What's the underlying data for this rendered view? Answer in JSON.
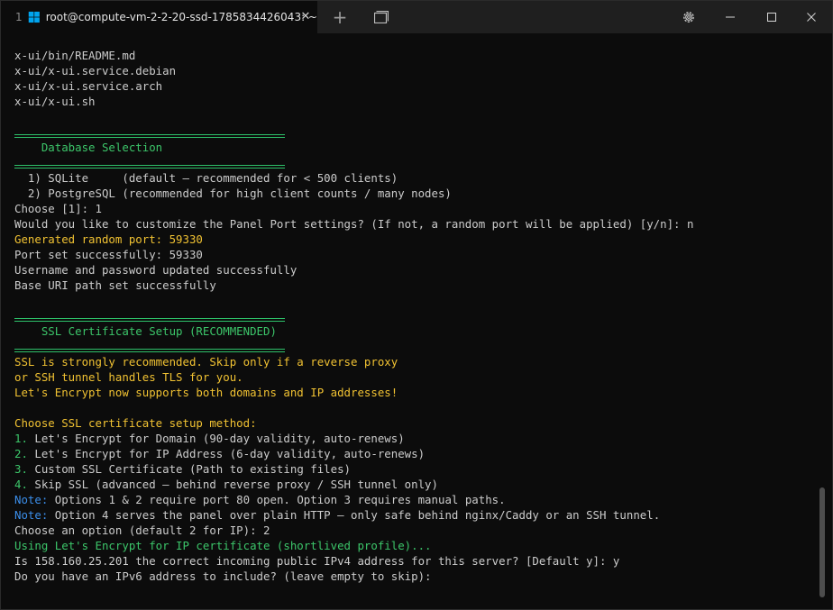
{
  "tab": {
    "index": "1",
    "title": "root@compute-vm-2-2-20-ssd-1785834426043: ~",
    "close_glyph": "✕",
    "icon": "windows-logo-icon"
  },
  "titlebar": {
    "new_tab_glyph": "+",
    "tab_view_icon": "tab-overview-icon",
    "settings_icon": "gear-icon",
    "minimize_icon": "minimize-icon",
    "maximize_icon": "maximize-icon",
    "close_icon": "close-icon"
  },
  "terminal": {
    "lines": [
      {
        "text": "x-ui/bin/README.md",
        "color": "default"
      },
      {
        "text": "x-ui/x-ui.service.debian",
        "color": "default"
      },
      {
        "text": "x-ui/x-ui.service.arch",
        "color": "default"
      },
      {
        "text": "x-ui/x-ui.sh",
        "color": "default"
      },
      {
        "text": "",
        "color": "default"
      },
      {
        "sep": true
      },
      {
        "text": "    Database Selection",
        "color": "green"
      },
      {
        "sep": true
      },
      {
        "text": "  1) SQLite     (default — recommended for < 500 clients)",
        "color": "default"
      },
      {
        "text": "  2) PostgreSQL (recommended for high client counts / many nodes)",
        "color": "default"
      },
      {
        "text": "Choose [1]: 1",
        "color": "default"
      },
      {
        "text": "Would you like to customize the Panel Port settings? (If not, a random port will be applied) [y/n]: n",
        "color": "default"
      },
      {
        "text": "Generated random port: 59330",
        "color": "yellow"
      },
      {
        "text": "Port set successfully: 59330",
        "color": "default"
      },
      {
        "text": "Username and password updated successfully",
        "color": "default"
      },
      {
        "text": "Base URI path set successfully",
        "color": "default"
      },
      {
        "text": "",
        "color": "default"
      },
      {
        "sep": true
      },
      {
        "text": "    SSL Certificate Setup (RECOMMENDED)",
        "color": "green"
      },
      {
        "sep": true
      },
      {
        "text": "SSL is strongly recommended. Skip only if a reverse proxy",
        "color": "yellow"
      },
      {
        "text": "or SSH tunnel handles TLS for you.",
        "color": "yellow"
      },
      {
        "text": "Let's Encrypt now supports both domains and IP addresses!",
        "color": "yellow"
      },
      {
        "text": "",
        "color": "default"
      },
      {
        "text": "Choose SSL certificate setup method:",
        "color": "yellow"
      },
      {
        "prefix": "1.",
        "prefix_color": "green",
        "text": " Let's Encrypt for Domain (90-day validity, auto-renews)",
        "color": "default"
      },
      {
        "prefix": "2.",
        "prefix_color": "green",
        "text": " Let's Encrypt for IP Address (6-day validity, auto-renews)",
        "color": "default"
      },
      {
        "prefix": "3.",
        "prefix_color": "green",
        "text": " Custom SSL Certificate (Path to existing files)",
        "color": "default"
      },
      {
        "prefix": "4.",
        "prefix_color": "green",
        "text": " Skip SSL (advanced — behind reverse proxy / SSH tunnel only)",
        "color": "default"
      },
      {
        "prefix": "Note:",
        "prefix_color": "blue",
        "text": " Options 1 & 2 require port 80 open. Option 3 requires manual paths.",
        "color": "default"
      },
      {
        "prefix": "Note:",
        "prefix_color": "blue",
        "text": " Option 4 serves the panel over plain HTTP — only safe behind nginx/Caddy or an SSH tunnel.",
        "color": "default"
      },
      {
        "text": "Choose an option (default 2 for IP): 2",
        "color": "default"
      },
      {
        "text": "Using Let's Encrypt for IP certificate (shortlived profile)...",
        "color": "green"
      },
      {
        "text": "Is 158.160.25.201 the correct incoming public IPv4 address for this server? [Default y]: y",
        "color": "default"
      },
      {
        "text": "Do you have an IPv6 address to include? (leave empty to skip):",
        "color": "default"
      }
    ]
  },
  "colors": {
    "background": "#0c0c0c",
    "foreground": "#cccccc",
    "yellow": "#f1c232",
    "green": "#3cc66a",
    "blue": "#3b8eea",
    "separator": "#2ec26a"
  }
}
